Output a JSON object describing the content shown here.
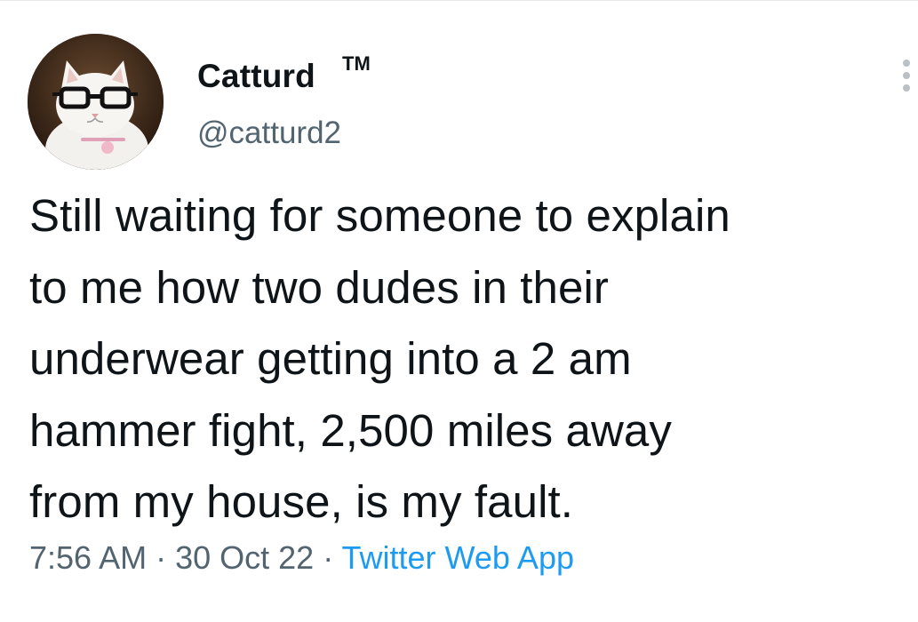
{
  "author": {
    "display_name": "Catturd",
    "trademark": "TM",
    "handle": "@catturd2"
  },
  "tweet": {
    "text_lines": [
      "Still waiting for someone to explain",
      "to me how two dudes in their",
      "underwear getting into a 2 am",
      "hammer fight, 2,500 miles away",
      "from my house, is my fault."
    ]
  },
  "meta": {
    "time": "7:56 AM",
    "separator": " · ",
    "date": "30 Oct 22",
    "source": "Twitter Web App"
  },
  "colors": {
    "text": "#0f1419",
    "muted": "#536471",
    "link": "#1d9bf0"
  },
  "icons": {
    "avatar": "cat-with-glasses-avatar",
    "more": "more-vertical-icon"
  }
}
